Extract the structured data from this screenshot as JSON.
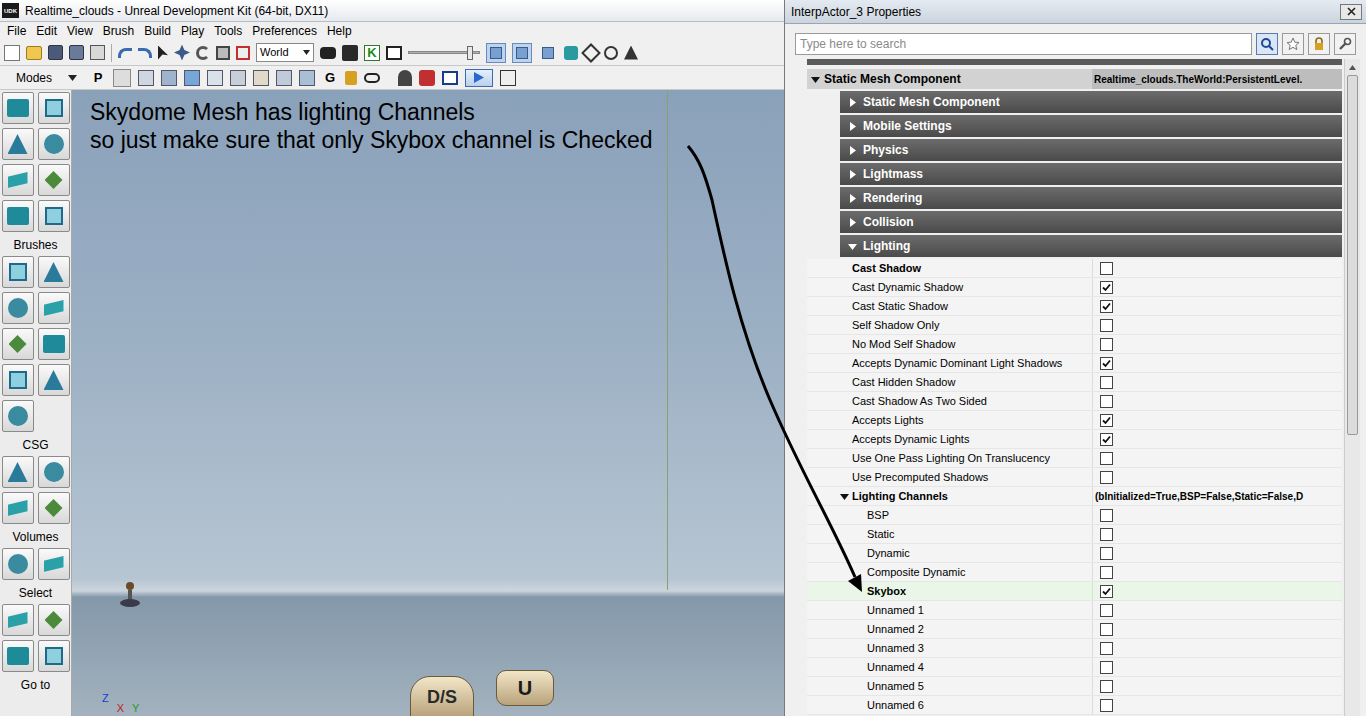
{
  "editor": {
    "logo": "UDK",
    "title": "Realtime_clouds - Unreal Development Kit (64-bit, DX11)",
    "menu": [
      "File",
      "Edit",
      "View",
      "Brush",
      "Build",
      "Play",
      "Tools",
      "Preferences",
      "Help"
    ],
    "coordinate_system": "World",
    "kismet_key": "K",
    "toolbar_slider_level": 0.9,
    "view_toggles": [
      {
        "selected": true
      },
      {
        "selected": true
      },
      {
        "selected": false
      }
    ],
    "toolbar2_letters": [
      "P",
      "G"
    ],
    "modes": {
      "title": "Modes",
      "sections": [
        "Brushes",
        "CSG",
        "Volumes",
        "Select",
        "Go to"
      ]
    },
    "viewport": {
      "annotation": [
        "Skydome Mesh has lighting Channels",
        "so just make sure that only Skybox channel is Checked"
      ],
      "sprites": [
        "D/S",
        "U"
      ],
      "axes": [
        "Z",
        "X",
        "Y"
      ]
    }
  },
  "properties": {
    "title": "InterpActor_3 Properties",
    "search_placeholder": "Type here to search",
    "component": {
      "label": "Static Mesh Component",
      "value": "Realtime_clouds.TheWorld:PersistentLevel.",
      "expanded": true
    },
    "categories": [
      {
        "label": "Static Mesh Component",
        "expanded": false
      },
      {
        "label": "Mobile Settings",
        "expanded": false
      },
      {
        "label": "Physics",
        "expanded": false
      },
      {
        "label": "Lightmass",
        "expanded": false
      },
      {
        "label": "Rendering",
        "expanded": false
      },
      {
        "label": "Collision",
        "expanded": false
      },
      {
        "label": "Lighting",
        "expanded": true
      }
    ],
    "lighting": [
      {
        "label": "Cast Shadow",
        "checked": false,
        "modified": true
      },
      {
        "label": "Cast Dynamic Shadow",
        "checked": true,
        "modified": false
      },
      {
        "label": "Cast Static Shadow",
        "checked": true,
        "modified": false
      },
      {
        "label": "Self Shadow Only",
        "checked": false,
        "modified": false
      },
      {
        "label": "No Mod Self Shadow",
        "checked": false,
        "modified": false
      },
      {
        "label": "Accepts Dynamic Dominant Light Shadows",
        "checked": true,
        "modified": false
      },
      {
        "label": "Cast Hidden Shadow",
        "checked": false,
        "modified": false
      },
      {
        "label": "Cast Shadow As Two Sided",
        "checked": false,
        "modified": false
      },
      {
        "label": "Accepts Lights",
        "checked": true,
        "modified": false
      },
      {
        "label": "Accepts Dynamic Lights",
        "checked": true,
        "modified": false
      },
      {
        "label": "Use One Pass Lighting On Translucency",
        "checked": false,
        "modified": false
      },
      {
        "label": "Use Precomputed Shadows",
        "checked": false,
        "modified": false
      }
    ],
    "lighting_channels": {
      "label": "Lighting Channels",
      "value": "(bInitialized=True,BSP=False,Static=False,D",
      "expanded": true,
      "channels": [
        {
          "label": "BSP",
          "checked": false,
          "selected": false,
          "modified": false
        },
        {
          "label": "Static",
          "checked": false,
          "selected": false,
          "modified": false
        },
        {
          "label": "Dynamic",
          "checked": false,
          "selected": false,
          "modified": false
        },
        {
          "label": "Composite Dynamic",
          "checked": false,
          "selected": false,
          "modified": false
        },
        {
          "label": "Skybox",
          "checked": true,
          "selected": true,
          "modified": true
        },
        {
          "label": "Unnamed 1",
          "checked": false,
          "selected": false,
          "modified": false
        },
        {
          "label": "Unnamed 2",
          "checked": false,
          "selected": false,
          "modified": false
        },
        {
          "label": "Unnamed 3",
          "checked": false,
          "selected": false,
          "modified": false
        },
        {
          "label": "Unnamed 4",
          "checked": false,
          "selected": false,
          "modified": false
        },
        {
          "label": "Unnamed 5",
          "checked": false,
          "selected": false,
          "modified": false
        },
        {
          "label": "Unnamed 6",
          "checked": false,
          "selected": false,
          "modified": false
        }
      ]
    }
  }
}
